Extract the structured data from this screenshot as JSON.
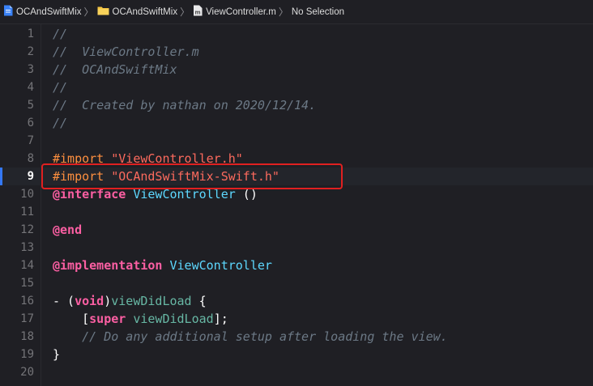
{
  "breadcrumbs": [
    {
      "label": "OCAndSwiftMix",
      "icon": "project-file-icon"
    },
    {
      "label": "OCAndSwiftMix",
      "icon": "folder-icon"
    },
    {
      "label": "ViewController.m",
      "icon": "objc-m-file-icon"
    },
    {
      "label": "No Selection",
      "icon": ""
    }
  ],
  "current_line": 9,
  "colors": {
    "background": "#1f1f24",
    "comment": "#6c7986",
    "preprocessor": "#fd8f3f",
    "string": "#fc6a5d",
    "keyword": "#fc5fa3",
    "type": "#5dd8ff",
    "function": "#67b7a4",
    "highlight_box": "#e02020",
    "current_line_marker": "#3478f6"
  },
  "lines": [
    {
      "n": "1",
      "tokens": [
        [
          "comment",
          "//"
        ]
      ]
    },
    {
      "n": "2",
      "tokens": [
        [
          "comment",
          "//  ViewController.m"
        ]
      ]
    },
    {
      "n": "3",
      "tokens": [
        [
          "comment",
          "//  OCAndSwiftMix"
        ]
      ]
    },
    {
      "n": "4",
      "tokens": [
        [
          "comment",
          "//"
        ]
      ]
    },
    {
      "n": "5",
      "tokens": [
        [
          "comment",
          "//  Created by nathan on 2020/12/14."
        ]
      ]
    },
    {
      "n": "6",
      "tokens": [
        [
          "comment",
          "//"
        ]
      ]
    },
    {
      "n": "7",
      "tokens": []
    },
    {
      "n": "8",
      "tokens": [
        [
          "pre",
          "#import "
        ],
        [
          "str",
          "\"ViewController.h\""
        ]
      ]
    },
    {
      "n": "9",
      "tokens": [
        [
          "pre",
          "#import "
        ],
        [
          "str",
          "\"OCAndSwiftMix-Swift.h\""
        ]
      ]
    },
    {
      "n": "10",
      "tokens": [
        [
          "kw",
          "@interface"
        ],
        [
          "plain",
          " "
        ],
        [
          "type",
          "ViewController"
        ],
        [
          "plain",
          " ()"
        ]
      ]
    },
    {
      "n": "11",
      "tokens": []
    },
    {
      "n": "12",
      "tokens": [
        [
          "kw",
          "@end"
        ]
      ]
    },
    {
      "n": "13",
      "tokens": []
    },
    {
      "n": "14",
      "tokens": [
        [
          "kw",
          "@implementation"
        ],
        [
          "plain",
          " "
        ],
        [
          "type",
          "ViewController"
        ]
      ]
    },
    {
      "n": "15",
      "tokens": []
    },
    {
      "n": "16",
      "tokens": [
        [
          "plain",
          "- ("
        ],
        [
          "kw",
          "void"
        ],
        [
          "plain",
          ")"
        ],
        [
          "fn",
          "viewDidLoad"
        ],
        [
          "plain",
          " {"
        ]
      ]
    },
    {
      "n": "17",
      "tokens": [
        [
          "plain",
          "    ["
        ],
        [
          "kw",
          "super"
        ],
        [
          "plain",
          " "
        ],
        [
          "fn",
          "viewDidLoad"
        ],
        [
          "plain",
          "];"
        ]
      ]
    },
    {
      "n": "18",
      "tokens": [
        [
          "plain",
          "    "
        ],
        [
          "comment",
          "// Do any additional setup after loading the view."
        ]
      ]
    },
    {
      "n": "19",
      "tokens": [
        [
          "plain",
          "}"
        ]
      ]
    },
    {
      "n": "20",
      "tokens": []
    }
  ]
}
